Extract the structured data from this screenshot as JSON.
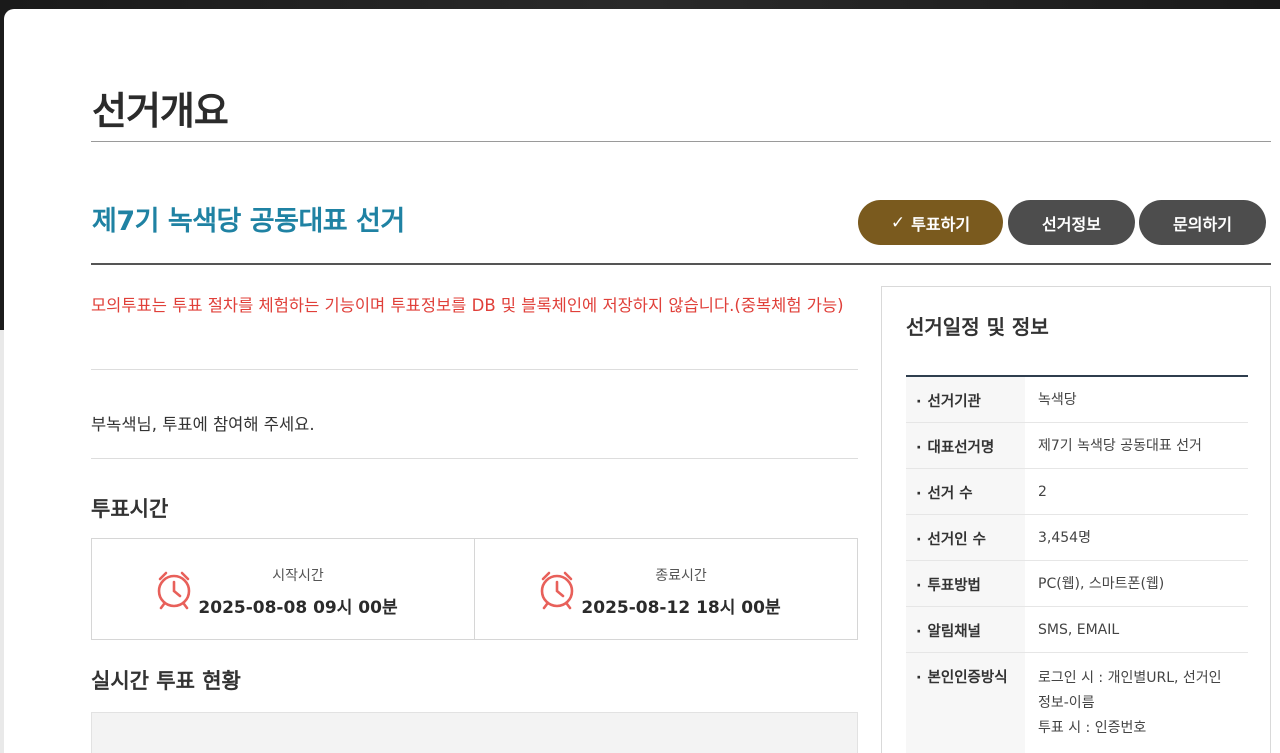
{
  "page": {
    "title": "선거개요"
  },
  "election": {
    "name": "제7기 녹색당 공동대표 선거"
  },
  "actions": {
    "vote_label": "투표하기",
    "info_label": "선거정보",
    "ask_label": "문의하기"
  },
  "notice": "모의투표는 투표 절차를 체험하는 기능이며 투표정보를 DB 및 블록체인에 저장하지 않습니다.(중복체험 가능)",
  "greeting": "부녹색님, 투표에 참여해 주세요.",
  "vote_time": {
    "title": "투표시간",
    "start_label": "시작시간",
    "start_value": "2025-08-08 09시 00분",
    "end_label": "종료시간",
    "end_value": "2025-08-12 18시 00분"
  },
  "live_status": {
    "title": "실시간 투표 현황"
  },
  "info_panel": {
    "title": "선거일정 및 정보",
    "rows": [
      {
        "key": "선거기관",
        "value": "녹색당"
      },
      {
        "key": "대표선거명",
        "value": "제7기 녹색당 공동대표 선거"
      },
      {
        "key": "선거 수",
        "value": "2"
      },
      {
        "key": "선거인 수",
        "value": "3,454명"
      },
      {
        "key": "투표방법",
        "value": "PC(웹), 스마트폰(웹)"
      },
      {
        "key": "알림채널",
        "value": "SMS, EMAIL"
      },
      {
        "key": "본인인증방식",
        "value_lines": [
          "로그인 시 : 개인별URL, 선거인",
          "정보-이름",
          "투표 시 : 인증번호"
        ]
      }
    ]
  },
  "colors": {
    "accent_blue": "#1f82a3",
    "vote_button": "#7a5a1e",
    "dark_button": "#4d4d4d",
    "notice_red": "#e0403a",
    "clock_icon": "#e8605a"
  },
  "icons": {
    "check": "check-icon",
    "clock": "alarm-clock-icon"
  }
}
